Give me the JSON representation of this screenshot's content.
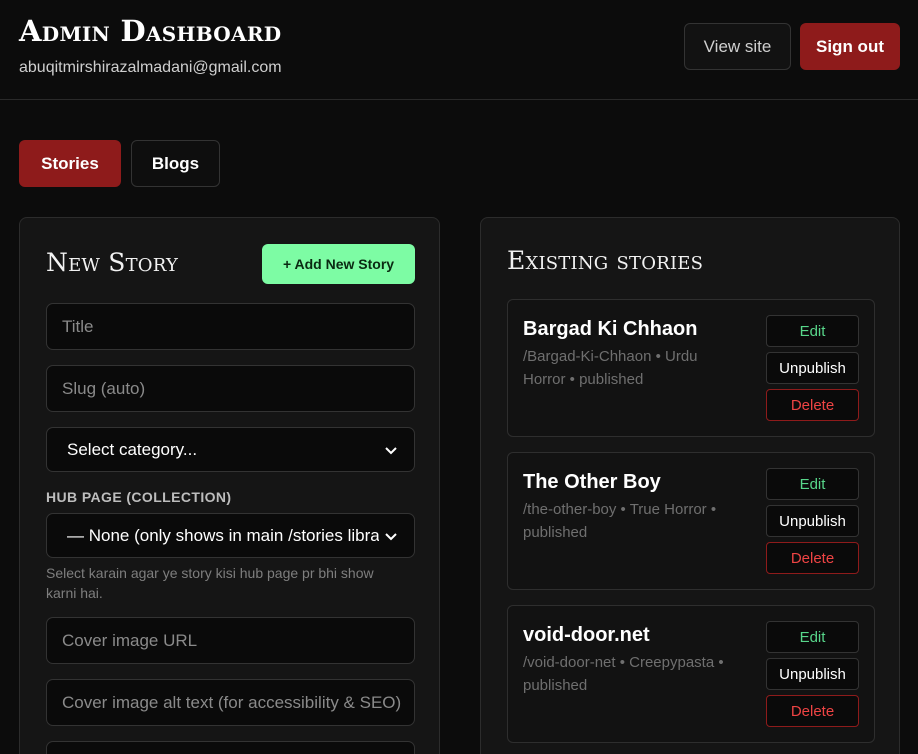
{
  "header": {
    "title": "Admin Dashboard",
    "email": "abuqitmirshirazalmadani@gmail.com",
    "view_site": "View site",
    "sign_out": "Sign out"
  },
  "tabs": [
    {
      "label": "Stories",
      "active": true
    },
    {
      "label": "Blogs",
      "active": false
    }
  ],
  "new_story": {
    "title": "New Story",
    "add_button": "+ Add New Story",
    "title_placeholder": "Title",
    "slug_placeholder": "Slug (auto)",
    "category_value": "Select category...",
    "hub_label": "HUB PAGE (COLLECTION)",
    "hub_value": "— None (only shows in main /stories library)",
    "hub_help": "Select karain agar ye story kisi hub page pr bhi show karni hai.",
    "cover_url_placeholder": "Cover image URL",
    "cover_alt_placeholder": "Cover image alt text (for accessibility & SEO)"
  },
  "existing": {
    "title": "Existing stories",
    "stories": [
      {
        "title": "Bargad Ki Chhaon",
        "meta": "/Bargad-Ki-Chhaon • Urdu Horror • published",
        "edit": "Edit",
        "unpublish": "Unpublish",
        "delete": "Delete"
      },
      {
        "title": "The Other Boy",
        "meta": "/the-other-boy • True Horror • published",
        "edit": "Edit",
        "unpublish": "Unpublish",
        "delete": "Delete"
      },
      {
        "title": "void-door.net",
        "meta": "/void-door-net • Creepypasta • published",
        "edit": "Edit",
        "unpublish": "Unpublish",
        "delete": "Delete"
      }
    ]
  },
  "colors": {
    "accent_red": "#8e1b1b",
    "accent_green": "#7dfca4",
    "background": "#0c0c0c",
    "panel": "#151515"
  },
  "icons": {
    "select_chevron": "chevron-down-icon"
  }
}
